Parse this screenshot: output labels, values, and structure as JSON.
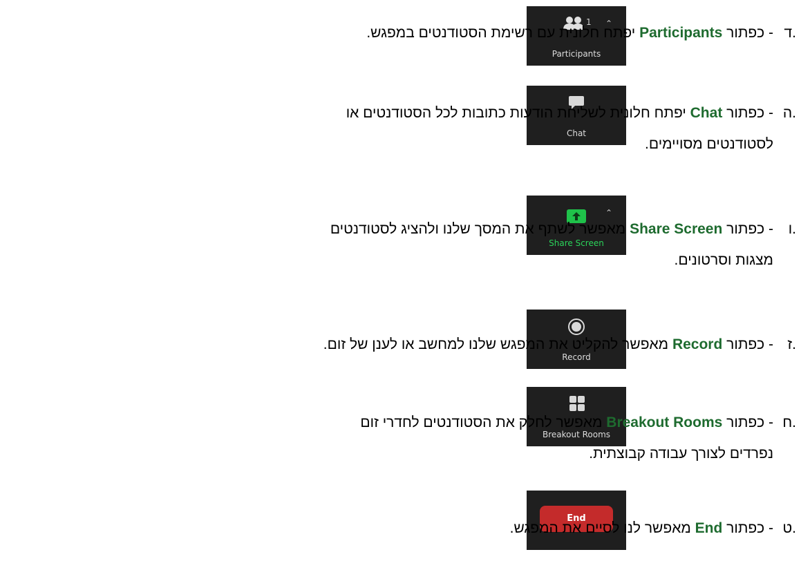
{
  "items": [
    {
      "letter": "ד.",
      "sep": " - כפתור ",
      "term": "Participants",
      "desc": " יפתח חלונית עם רשימת הסטודנטים במפגש.",
      "line2": "",
      "button": {
        "label": "Participants",
        "count": "1",
        "icon": "participants-icon"
      }
    },
    {
      "letter": "ה.",
      "sep": " - כפתור ",
      "term": "Chat",
      "desc": " יפתח חלונית לשליחת הודעות כתובות לכל הסטודנטים או",
      "line2": "לסטודנטים מסויימים.",
      "button": {
        "label": "Chat",
        "icon": "chat-icon"
      }
    },
    {
      "letter": "ו.",
      "sep": " - כפתור ",
      "term": "Share Screen",
      "desc": " מאפשר לשתף את המסך שלנו ולהציג לסטודנטים",
      "line2": "מצגות וסרטונים.",
      "button": {
        "label": "Share Screen",
        "icon": "share-screen-icon"
      }
    },
    {
      "letter": "ז.",
      "sep": " - כפתור ",
      "term": "Record",
      "desc": " מאפשר להקליט את המפגש שלנו למחשב או לענן של זום.",
      "line2": "",
      "button": {
        "label": "Record",
        "icon": "record-icon"
      }
    },
    {
      "letter": "ח.",
      "sep": " - כפתור ",
      "term": "Breakout Rooms",
      "desc": " מאפשר לחלק את הסטודנטים לחדרי זום",
      "line2": "נפרדים לצורך עבודה קבוצתית.",
      "button": {
        "label": "Breakout Rooms",
        "icon": "breakout-rooms-icon"
      }
    },
    {
      "letter": "ט.",
      "sep": " - כפתור ",
      "term": "End",
      "desc": " מאפשר לנו לסיים את המפגש.",
      "line2": "",
      "button": {
        "label": "End",
        "icon": ""
      }
    }
  ],
  "colors": {
    "term": "#1e6b2f",
    "button_bg": "#1f1f1f",
    "share_green": "#1fc24a",
    "end_red": "#c42b2b"
  }
}
